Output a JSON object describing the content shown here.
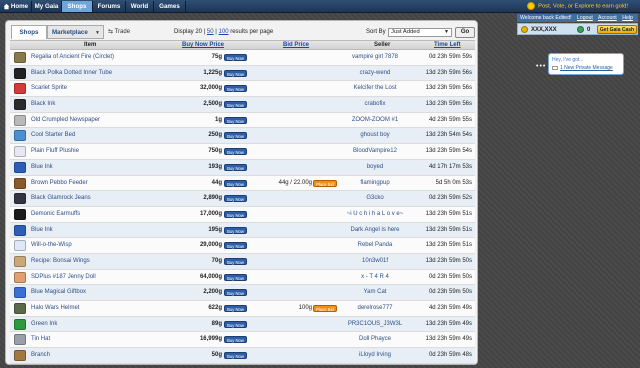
{
  "nav": {
    "tabs": [
      {
        "label": "Home"
      },
      {
        "label": "My Gaia"
      },
      {
        "label": "Shops"
      },
      {
        "label": "Forums"
      },
      {
        "label": "World"
      },
      {
        "label": "Games"
      }
    ],
    "promo": "Post, Vote, or Explore to earn gold!"
  },
  "account": {
    "welcome": "Welcome back Edited!",
    "logout": "Logout",
    "account": "Account",
    "help": "Help",
    "gold": "XXX,XXX",
    "cash": "0",
    "get_cash": "Get Gaia Cash"
  },
  "pm": {
    "greeting": "Hey, I've got...",
    "message": "1 New Private Message"
  },
  "market": {
    "tab_shops": "Shops",
    "tab_marketplace": "Marketplace",
    "tab_trade": "Trade",
    "display_prefix": "Display 20 |",
    "display_50": "50",
    "display_sep": "|",
    "display_100": "100",
    "display_suffix": "results per page",
    "sort_label": "Sort By",
    "sort_value": "Just Added",
    "go_label": "Go"
  },
  "columns": {
    "item": "Item",
    "buy_now_price": "Buy Now Price",
    "bid_price": "Bid Price",
    "seller": "Seller",
    "time_left": "Time Left"
  },
  "buttons": {
    "buy_now": "Buy Now",
    "place_bid": "Place Bid"
  },
  "rows": [
    {
      "name": "Regalia of Ancient Fire (Circlet)",
      "price": "75g",
      "bid": "",
      "seller": "vampire girl 7878",
      "time": "0d 23h 59m 59s",
      "icon_color": "#8a7a4a"
    },
    {
      "name": "Black Polka Dotted Inner Tube",
      "price": "1,225g",
      "bid": "",
      "seller": "crazy-wend",
      "time": "13d 23h 59m 56s",
      "icon_color": "#222222"
    },
    {
      "name": "Scarlet Sprite",
      "price": "32,000g",
      "bid": "",
      "seller": "Kelcifer the Lost",
      "time": "13d 23h 59m 56s",
      "icon_color": "#d43a3a"
    },
    {
      "name": "Black Ink",
      "price": "2,500g",
      "bid": "",
      "seller": "crabofix",
      "time": "13d 23h 59m 56s",
      "icon_color": "#2b2b2b"
    },
    {
      "name": "Old Crumpled Newspaper",
      "price": "1g",
      "bid": "",
      "seller": "ZOOM-ZOOM #1",
      "time": "4d 23h 59m 55s",
      "icon_color": "#b9b9b9"
    },
    {
      "name": "Cool Starter Bed",
      "price": "250g",
      "bid": "",
      "seller": "ghoust boy",
      "time": "13d 23h 54m 54s",
      "icon_color": "#4a8fd0"
    },
    {
      "name": "Plain Fluff Plushie",
      "price": "750g",
      "bid": "",
      "seller": "BloodVampire12",
      "time": "13d 23h 59m 54s",
      "icon_color": "#e8e8f4"
    },
    {
      "name": "Blue Ink",
      "price": "193g",
      "bid": "",
      "seller": "boyed",
      "time": "4d 17h 17m 53s",
      "icon_color": "#2e5fb8"
    },
    {
      "name": "Brown Pebbo Feeder",
      "price": "44g",
      "bid": "44g / 22.00g",
      "seller": "flamingpup",
      "time": "5d 5h 0m 53s",
      "icon_color": "#8a5a2a"
    },
    {
      "name": "Black Glamrock Jeans",
      "price": "2,890g",
      "bid": "",
      "seller": "G3cko",
      "time": "0d 23h 59m 52s",
      "icon_color": "#333344"
    },
    {
      "name": "Demonic Earmuffs",
      "price": "17,000g",
      "bid": "",
      "seller": "~i U c h i h a L o v e~",
      "time": "13d 23h 59m 51s",
      "icon_color": "#1a1a1a"
    },
    {
      "name": "Blue Ink",
      "price": "195g",
      "bid": "",
      "seller": "Dark Angel is here",
      "time": "13d 23h 59m 51s",
      "icon_color": "#2e5fb8"
    },
    {
      "name": "Will-o-the-Wisp",
      "price": "29,000g",
      "bid": "",
      "seller": "Rebel Panda",
      "time": "13d 23h 59m 51s",
      "icon_color": "#dfe8f8"
    },
    {
      "name": "Recipe: Bonsai Wings",
      "price": "70g",
      "bid": "",
      "seller": "10n3w01f",
      "time": "13d 23h 59m 50s",
      "icon_color": "#c8a878"
    },
    {
      "name": "SDPlus #187 Jenny Doll",
      "price": "64,000g",
      "bid": "",
      "seller": "x - T 4 R 4",
      "time": "0d 23h 59m 50s",
      "icon_color": "#e0a070"
    },
    {
      "name": "Blue Magical Giftbox",
      "price": "2,200g",
      "bid": "",
      "seller": "Yam Cat",
      "time": "0d 23h 59m 50s",
      "icon_color": "#3a6fd8"
    },
    {
      "name": "Halo Wars Helmet",
      "price": "622g",
      "bid": "100g",
      "seller": "derelrose777",
      "time": "4d 23h 59m 49s",
      "icon_color": "#5a6a4a"
    },
    {
      "name": "Green Ink",
      "price": "89g",
      "bid": "",
      "seller": "PR3C1OUS_J3W3L",
      "time": "13d 23h 59m 49s",
      "icon_color": "#2e9a3e"
    },
    {
      "name": "Tin Hat",
      "price": "16,999g",
      "bid": "",
      "seller": "Doll Phayce",
      "time": "13d 23h 59m 49s",
      "icon_color": "#9aa0a8"
    },
    {
      "name": "Branch",
      "price": "50g",
      "bid": "",
      "seller": "iLloyd Irving",
      "time": "0d 23h 59m 48s",
      "icon_color": "#a07840"
    }
  ]
}
